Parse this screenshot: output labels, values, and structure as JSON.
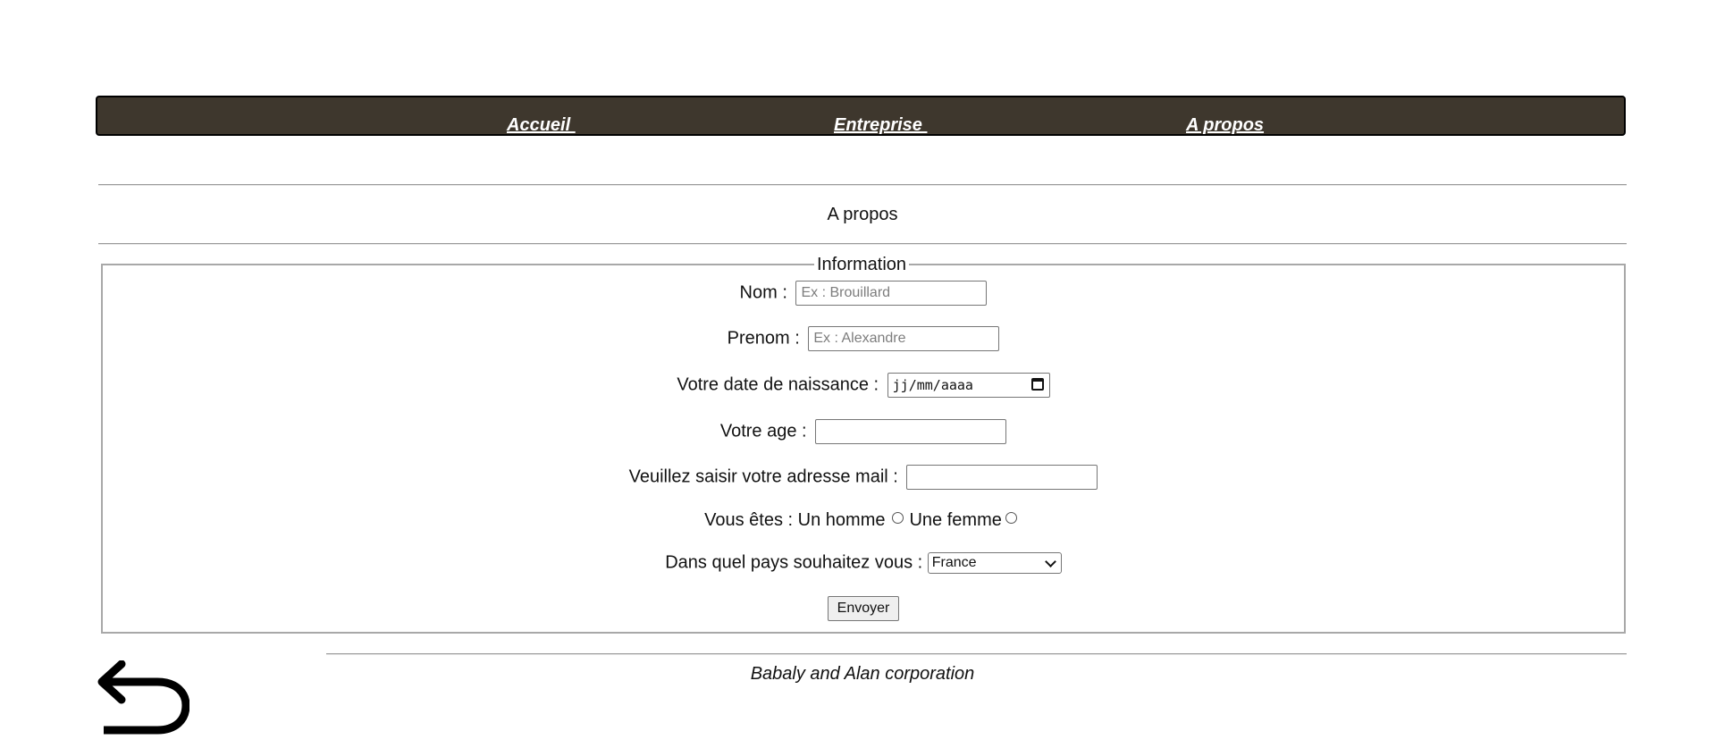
{
  "nav": {
    "items": [
      {
        "label": "Accueil "
      },
      {
        "label": "Entreprise "
      },
      {
        "label": "A propos"
      }
    ]
  },
  "section_title": "A propos",
  "form": {
    "legend": "Information",
    "nom": {
      "label": "Nom :",
      "placeholder": "Ex : Brouillard",
      "value": ""
    },
    "prenom": {
      "label": "Prenom :",
      "placeholder": "Ex : Alexandre",
      "value": ""
    },
    "naissance": {
      "label": "Votre date de naissance :",
      "placeholder": "jj/mm/aaaa"
    },
    "age": {
      "label": "Votre age :",
      "value": ""
    },
    "email": {
      "label": "Veuillez saisir votre adresse mail :",
      "value": ""
    },
    "gender": {
      "label": "Vous êtes :",
      "options": [
        {
          "label": "Un homme",
          "checked": false
        },
        {
          "label": "Une femme",
          "checked": false
        }
      ]
    },
    "country": {
      "label": "Dans quel pays souhaitez vous :",
      "selected": "France"
    },
    "submit_label": "Envoyer"
  },
  "footer": {
    "text": "Babaly and Alan corporation"
  },
  "icons": {
    "back": "back-arrow-icon"
  }
}
